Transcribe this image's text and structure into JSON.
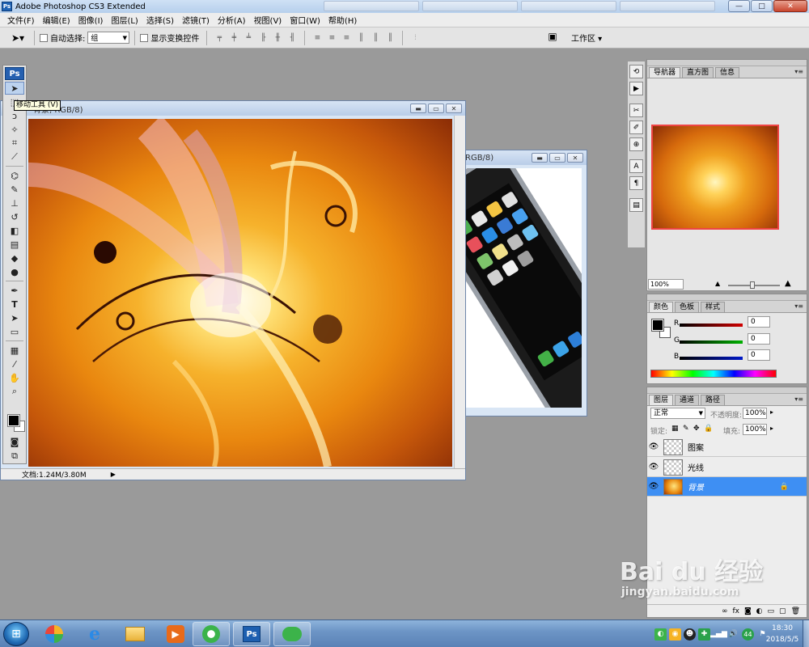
{
  "app": {
    "title": "Adobe Photoshop CS3 Extended",
    "logo": "Ps"
  },
  "ghost_tabs": [
    "",
    "",
    "",
    ""
  ],
  "window_controls": {
    "minimize": "—",
    "maximize": "□",
    "close": "✕"
  },
  "menu": [
    "文件(F)",
    "编辑(E)",
    "图像(I)",
    "图层(L)",
    "选择(S)",
    "滤镜(T)",
    "分析(A)",
    "视图(V)",
    "窗口(W)",
    "帮助(H)"
  ],
  "options_bar": {
    "auto_select_label": "自动选择:",
    "auto_select_value": "组",
    "show_transform_label": "显示变换控件",
    "workspace_label": "工作区 ▾"
  },
  "tooltip": "移动工具 (V)",
  "doc1": {
    "title": "背景, RGB/8)",
    "status": "文档:1.24M/3.80M"
  },
  "doc2": {
    "title": "RGB/8)"
  },
  "navigator": {
    "tabs": [
      "导航器",
      "直方图",
      "信息"
    ],
    "zoom": "100%"
  },
  "color": {
    "tabs": [
      "颜色",
      "色板",
      "样式"
    ],
    "channels": [
      {
        "label": "R",
        "value": "0",
        "color": "#d00000"
      },
      {
        "label": "G",
        "value": "0",
        "color": "#00b000"
      },
      {
        "label": "B",
        "value": "0",
        "color": "#0018c8"
      }
    ]
  },
  "layers": {
    "tabs": [
      "图层",
      "通道",
      "路径"
    ],
    "blend_mode": "正常",
    "opacity_label": "不透明度:",
    "opacity_value": "100%",
    "lock_label": "锁定:",
    "fill_label": "填充:",
    "fill_value": "100%",
    "items": [
      {
        "name": "图案",
        "active": false
      },
      {
        "name": "光线",
        "active": false
      },
      {
        "name": "背景",
        "active": true
      }
    ]
  },
  "taskbar": {
    "apps": [
      "photo-viewer",
      "internet-explorer",
      "file-explorer",
      "media-player",
      "browser",
      "photoshop",
      "wechat"
    ],
    "tray_badge": "44",
    "time": "18:30",
    "date": "2018/5/5"
  },
  "watermark": {
    "brand": "Bai du 经验",
    "url": "jingyan.baidu.com"
  },
  "colors": {
    "selection_blue": "#3e8ff3",
    "taskbar_blue": "#6d95c6",
    "workspace_gray": "#9a9a9a"
  }
}
